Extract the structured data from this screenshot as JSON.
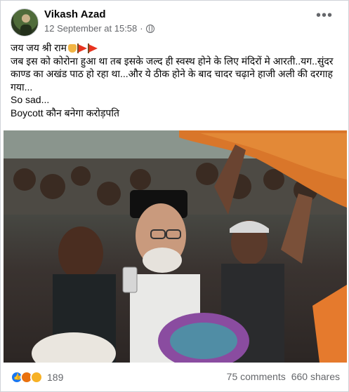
{
  "post": {
    "author": "Vikash Azad",
    "timestamp": "12 September at 15:58",
    "lines": [
      "जय जय श्री राम",
      "जब इस को कोरोना हुआ था तब इसके जल्द ही स्वस्थ होने के लिए मंदिरों मे आरती..यग..सुंदर काण्ड का अखंड पाठ हो रहा था...और ये ठीक होने के बाद चादर चढ़ाने हाजी अली की दरगाह गया...",
      "So sad...",
      "Boycott कौन बनेगा करोड़पति"
    ],
    "icons": {
      "more": "more-options-icon",
      "privacy": "globe-icon",
      "emoji": [
        "folded-hands-icon",
        "red-flag-icon",
        "red-flag-icon"
      ]
    }
  },
  "footer": {
    "reaction_count": "189",
    "comments": "75 comments",
    "shares": "660 shares",
    "reaction_icons": [
      "like-icon",
      "angry-icon",
      "haha-icon"
    ]
  },
  "colors": {
    "author_text": "#050505",
    "meta_text": "#65676b",
    "like_blue": "#1877f2",
    "chadar_orange": "#d9762a"
  }
}
